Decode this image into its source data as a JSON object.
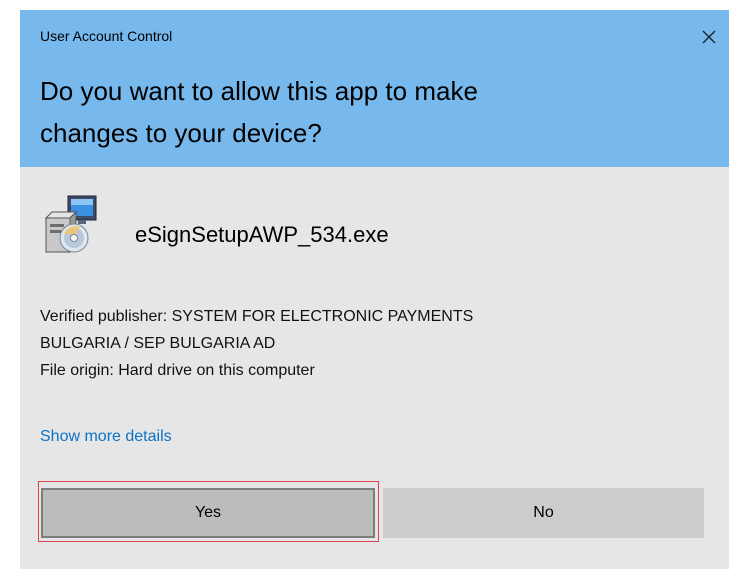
{
  "dialog": {
    "caption": "User Account Control",
    "question_line1": "Do you want to allow this app to make",
    "question_line2": "changes to your device?",
    "app": {
      "name": "eSignSetupAWP_534.exe",
      "icon": "installer-icon"
    },
    "publisher_line1": "Verified publisher: SYSTEM FOR ELECTRONIC PAYMENTS",
    "publisher_line2": "BULGARIA / SEP BULGARIA AD",
    "origin": "File origin: Hard drive on this computer",
    "more_details": "Show more details",
    "buttons": {
      "yes": "Yes",
      "no": "No"
    },
    "close_icon": "close-icon"
  },
  "colors": {
    "header": "#77b9ec",
    "body": "#e6e6e6",
    "link": "#0d72c3",
    "highlight": "#e0404a"
  }
}
